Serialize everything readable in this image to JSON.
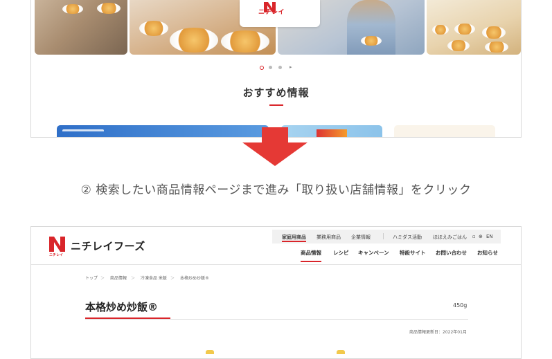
{
  "top_screenshot": {
    "logo_text": "ニチレイ",
    "section_title": "おすすめ情報",
    "carousel_next": "▸"
  },
  "instruction": "② 検索したい商品情報ページまで進み「取り扱い店舗情報」をクリック",
  "bottom_screenshot": {
    "brand_name": "ニチレイフーズ",
    "brand_mark_text": "ニチレイ",
    "top_nav": [
      "家庭用商品",
      "業務用商品",
      "企業情報",
      "ハミダス活動",
      "ほほえみごはん",
      "EN"
    ],
    "main_nav": [
      "商品情報",
      "レシピ",
      "キャンペーン",
      "特設サイト",
      "お問い合わせ",
      "お知らせ"
    ],
    "breadcrumb": [
      "トップ",
      "商品情報",
      "冷凍食品 米飯",
      "本格炒め炒飯®"
    ],
    "breadcrumb_separator": "＞",
    "product_title": "本格炒め炒飯®",
    "weight": "450g",
    "updated": "商品情報更新日：2022年01月"
  },
  "colors": {
    "accent_red": "#d9252a",
    "arrow_red": "#e53935"
  }
}
